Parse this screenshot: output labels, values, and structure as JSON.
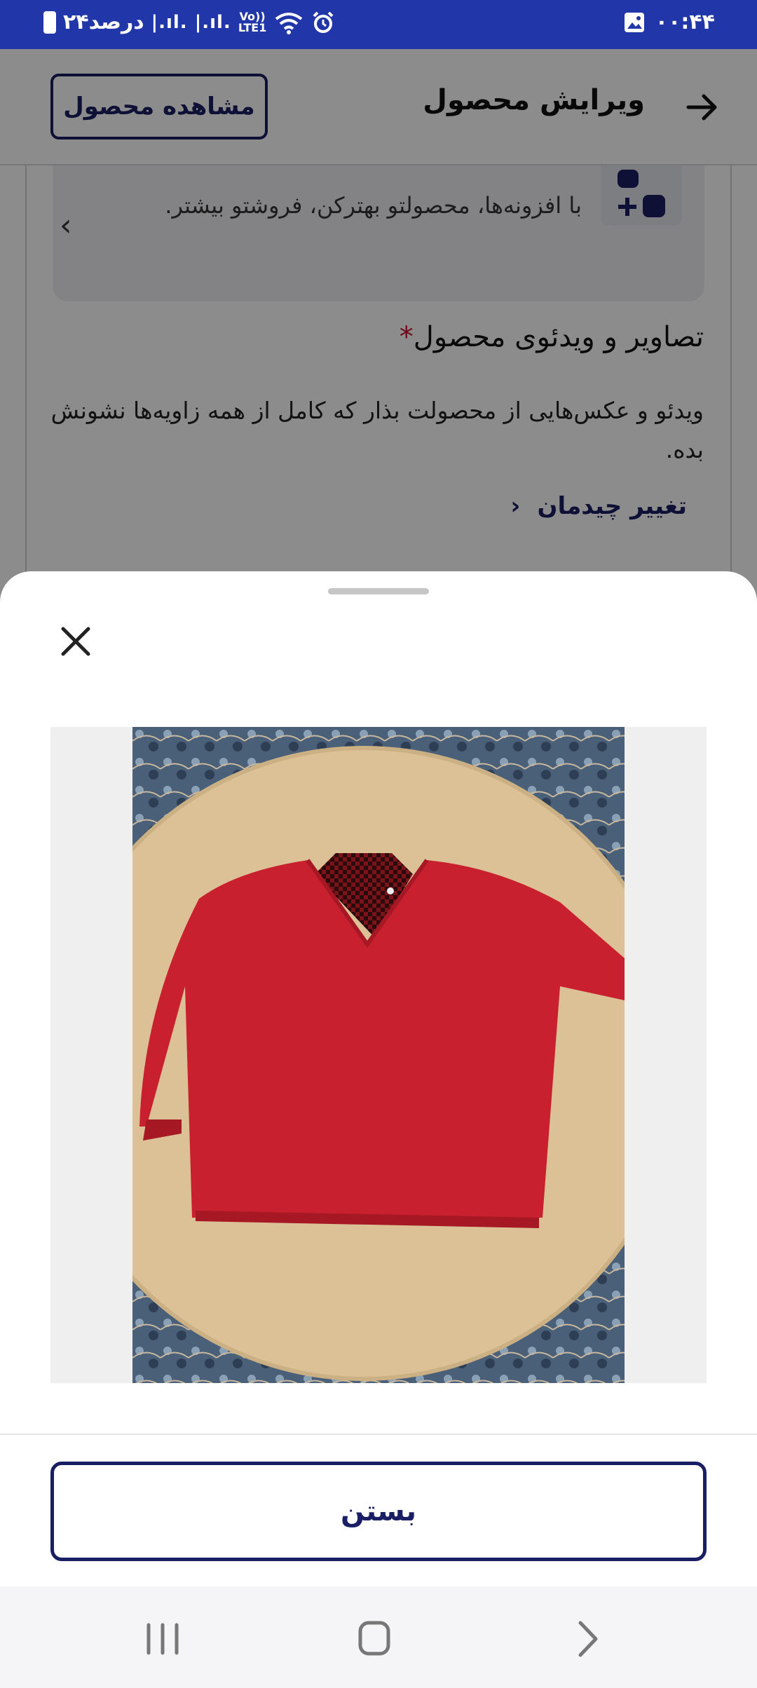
{
  "status_bar": {
    "time": "۰۰:۴۴",
    "battery_text": "۲۴درصد",
    "signal_text": "|.ıl. |.ıl.",
    "network_line1": "Vo))",
    "network_line2": "LTE1"
  },
  "header": {
    "title": "ویرایش محصول",
    "view_product_label": "مشاهده محصول"
  },
  "addon_banner": {
    "text": "با افزونه‌ها، محصولتو بهترکن، فروشتو بیشتر."
  },
  "media_section": {
    "title": "تصاویر و ویدئوی محصول",
    "required_mark": "*",
    "description": "ویدئو و عکس‌هایی از محصولت بذار که کامل از همه زاویه‌ها نشونش بده.",
    "change_layout_label": "تغییر چیدمان"
  },
  "sheet": {
    "close_label": "بستن"
  },
  "colors": {
    "status_bar": "#2136a8",
    "accent": "#1a1e63",
    "required": "#c8102e"
  },
  "icons": [
    "arrow-right-icon",
    "close-icon",
    "chevron-left-icon",
    "addon-icon",
    "recents-icon",
    "home-icon",
    "back-icon"
  ]
}
